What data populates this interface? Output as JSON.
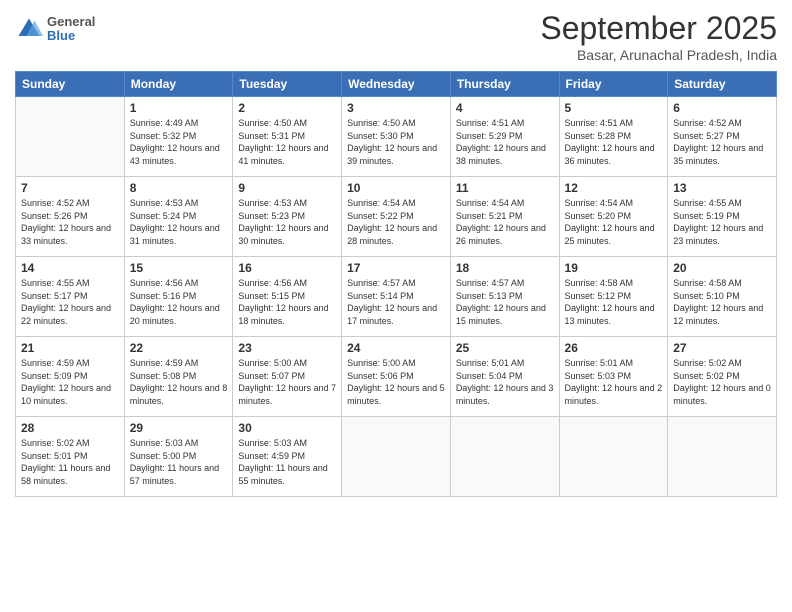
{
  "header": {
    "logo": {
      "general": "General",
      "blue": "Blue"
    },
    "title": "September 2025",
    "subtitle": "Basar, Arunachal Pradesh, India"
  },
  "weekdays": [
    "Sunday",
    "Monday",
    "Tuesday",
    "Wednesday",
    "Thursday",
    "Friday",
    "Saturday"
  ],
  "weeks": [
    [
      {
        "day": "",
        "empty": true
      },
      {
        "day": "1",
        "sunrise": "4:49 AM",
        "sunset": "5:32 PM",
        "daylight": "12 hours and 43 minutes."
      },
      {
        "day": "2",
        "sunrise": "4:50 AM",
        "sunset": "5:31 PM",
        "daylight": "12 hours and 41 minutes."
      },
      {
        "day": "3",
        "sunrise": "4:50 AM",
        "sunset": "5:30 PM",
        "daylight": "12 hours and 39 minutes."
      },
      {
        "day": "4",
        "sunrise": "4:51 AM",
        "sunset": "5:29 PM",
        "daylight": "12 hours and 38 minutes."
      },
      {
        "day": "5",
        "sunrise": "4:51 AM",
        "sunset": "5:28 PM",
        "daylight": "12 hours and 36 minutes."
      },
      {
        "day": "6",
        "sunrise": "4:52 AM",
        "sunset": "5:27 PM",
        "daylight": "12 hours and 35 minutes."
      }
    ],
    [
      {
        "day": "7",
        "sunrise": "4:52 AM",
        "sunset": "5:26 PM",
        "daylight": "12 hours and 33 minutes."
      },
      {
        "day": "8",
        "sunrise": "4:53 AM",
        "sunset": "5:24 PM",
        "daylight": "12 hours and 31 minutes."
      },
      {
        "day": "9",
        "sunrise": "4:53 AM",
        "sunset": "5:23 PM",
        "daylight": "12 hours and 30 minutes."
      },
      {
        "day": "10",
        "sunrise": "4:54 AM",
        "sunset": "5:22 PM",
        "daylight": "12 hours and 28 minutes."
      },
      {
        "day": "11",
        "sunrise": "4:54 AM",
        "sunset": "5:21 PM",
        "daylight": "12 hours and 26 minutes."
      },
      {
        "day": "12",
        "sunrise": "4:54 AM",
        "sunset": "5:20 PM",
        "daylight": "12 hours and 25 minutes."
      },
      {
        "day": "13",
        "sunrise": "4:55 AM",
        "sunset": "5:19 PM",
        "daylight": "12 hours and 23 minutes."
      }
    ],
    [
      {
        "day": "14",
        "sunrise": "4:55 AM",
        "sunset": "5:17 PM",
        "daylight": "12 hours and 22 minutes."
      },
      {
        "day": "15",
        "sunrise": "4:56 AM",
        "sunset": "5:16 PM",
        "daylight": "12 hours and 20 minutes."
      },
      {
        "day": "16",
        "sunrise": "4:56 AM",
        "sunset": "5:15 PM",
        "daylight": "12 hours and 18 minutes."
      },
      {
        "day": "17",
        "sunrise": "4:57 AM",
        "sunset": "5:14 PM",
        "daylight": "12 hours and 17 minutes."
      },
      {
        "day": "18",
        "sunrise": "4:57 AM",
        "sunset": "5:13 PM",
        "daylight": "12 hours and 15 minutes."
      },
      {
        "day": "19",
        "sunrise": "4:58 AM",
        "sunset": "5:12 PM",
        "daylight": "12 hours and 13 minutes."
      },
      {
        "day": "20",
        "sunrise": "4:58 AM",
        "sunset": "5:10 PM",
        "daylight": "12 hours and 12 minutes."
      }
    ],
    [
      {
        "day": "21",
        "sunrise": "4:59 AM",
        "sunset": "5:09 PM",
        "daylight": "12 hours and 10 minutes."
      },
      {
        "day": "22",
        "sunrise": "4:59 AM",
        "sunset": "5:08 PM",
        "daylight": "12 hours and 8 minutes."
      },
      {
        "day": "23",
        "sunrise": "5:00 AM",
        "sunset": "5:07 PM",
        "daylight": "12 hours and 7 minutes."
      },
      {
        "day": "24",
        "sunrise": "5:00 AM",
        "sunset": "5:06 PM",
        "daylight": "12 hours and 5 minutes."
      },
      {
        "day": "25",
        "sunrise": "5:01 AM",
        "sunset": "5:04 PM",
        "daylight": "12 hours and 3 minutes."
      },
      {
        "day": "26",
        "sunrise": "5:01 AM",
        "sunset": "5:03 PM",
        "daylight": "12 hours and 2 minutes."
      },
      {
        "day": "27",
        "sunrise": "5:02 AM",
        "sunset": "5:02 PM",
        "daylight": "12 hours and 0 minutes."
      }
    ],
    [
      {
        "day": "28",
        "sunrise": "5:02 AM",
        "sunset": "5:01 PM",
        "daylight": "11 hours and 58 minutes."
      },
      {
        "day": "29",
        "sunrise": "5:03 AM",
        "sunset": "5:00 PM",
        "daylight": "11 hours and 57 minutes."
      },
      {
        "day": "30",
        "sunrise": "5:03 AM",
        "sunset": "4:59 PM",
        "daylight": "11 hours and 55 minutes."
      },
      {
        "day": "",
        "empty": true
      },
      {
        "day": "",
        "empty": true
      },
      {
        "day": "",
        "empty": true
      },
      {
        "day": "",
        "empty": true
      }
    ]
  ]
}
